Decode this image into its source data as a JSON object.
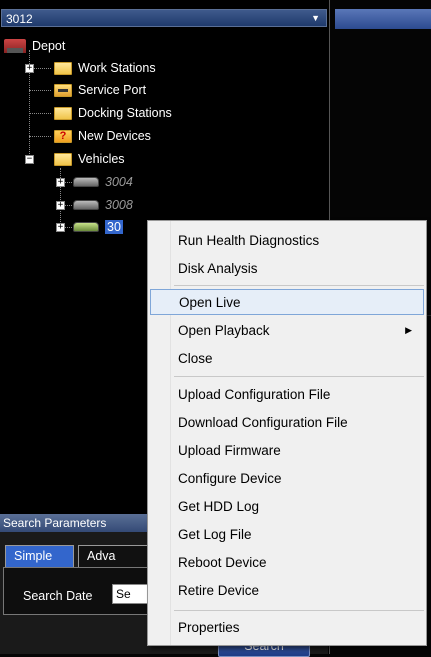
{
  "selector": {
    "value": "3012"
  },
  "tree": {
    "depot": "Depot",
    "work_stations": "Work Stations",
    "service_port": "Service Port",
    "docking_stations": "Docking Stations",
    "new_devices": "New Devices",
    "vehicles": "Vehicles",
    "vehicle_1": "3004",
    "vehicle_2": "3008",
    "vehicle_3": "30"
  },
  "search": {
    "header": "Search Parameters",
    "tab_simple": "Simple",
    "tab_advanced": "Adva",
    "search_date_label": "Search Date",
    "date_value": "Se",
    "button": "Search"
  },
  "context_menu": {
    "items": [
      "Run Health Diagnostics",
      "Disk Analysis",
      "Open Live",
      "Open Playback",
      "Close",
      "Upload Configuration File",
      "Download Configuration File",
      "Upload Firmware",
      "Configure Device",
      "Get HDD Log",
      "Get Log File",
      "Reboot Device",
      "Retire Device",
      "Properties"
    ],
    "highlighted": "Open Live",
    "submenu_arrow": "▶"
  },
  "colors": {
    "selection": "#3366cc",
    "header_blue": "#344a76",
    "menu_bg": "#f0f0f0",
    "menu_highlight": "#e6eef8"
  }
}
